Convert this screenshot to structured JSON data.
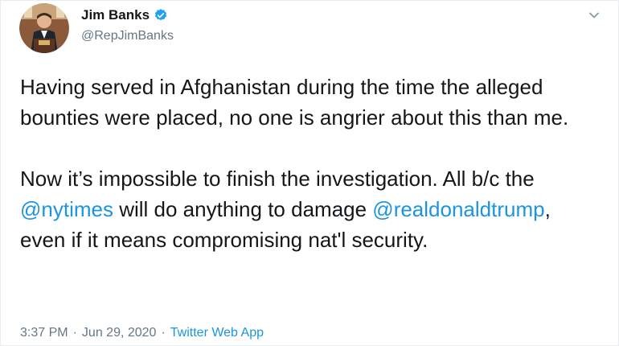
{
  "author": {
    "display_name": "Jim Banks",
    "handle": "@RepJimBanks",
    "verified": true,
    "avatar_icon": "avatar-portrait-icon"
  },
  "tweet": {
    "para1": "Having served in Afghanistan during the time the alleged bounties were placed, no one is angrier about this than me.",
    "para2_a": "Now it’s impossible to finish the investigation. All b/c the ",
    "mention1": "@nytimes",
    "para2_b": " will do anything to damage ",
    "mention2": "@realdonaldtrump",
    "para2_c": ", even if it means compromising nat'l security."
  },
  "meta": {
    "time": "3:37 PM",
    "sep1": "·",
    "date": "Jun 29, 2020",
    "sep2": "·",
    "source": "Twitter Web App"
  },
  "colors": {
    "link": "#1b95e0",
    "secondary_text": "#657786",
    "primary_text": "#14171a",
    "verified_badge": "#1da1f2"
  },
  "icons": {
    "caret": "chevron-down-icon",
    "verified": "verified-badge-icon"
  }
}
